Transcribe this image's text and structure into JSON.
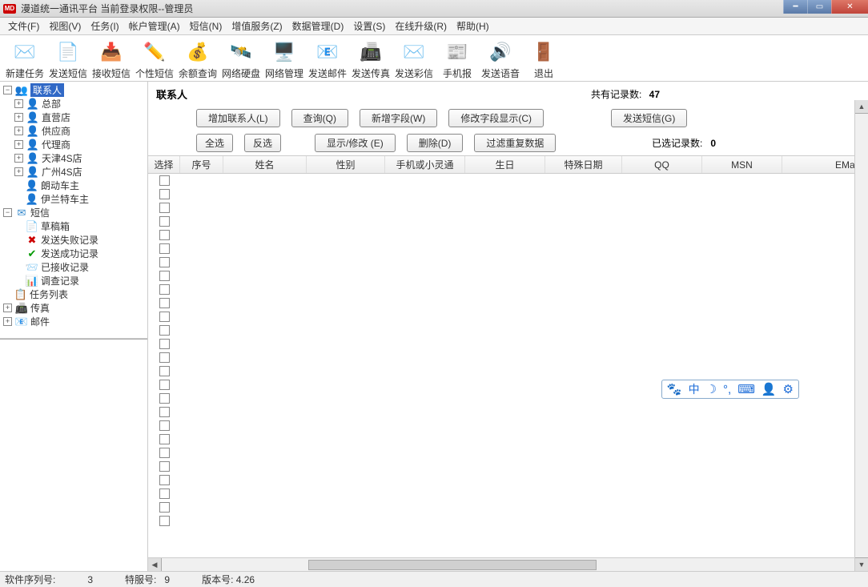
{
  "window": {
    "title": "漫道统一通讯平台 当前登录权限--管理员",
    "app_icon_text": "MD"
  },
  "menu": {
    "items": [
      "文件(F)",
      "视图(V)",
      "任务(I)",
      "帐户管理(A)",
      "短信(N)",
      "增值服务(Z)",
      "数据管理(D)",
      "设置(S)",
      "在线升级(R)",
      "帮助(H)"
    ]
  },
  "toolbar": {
    "items": [
      {
        "label": "新建任务",
        "icon": "✉️"
      },
      {
        "label": "发送短信",
        "icon": "📄"
      },
      {
        "label": "接收短信",
        "icon": "📥"
      },
      {
        "label": "个性短信",
        "icon": "✏️"
      },
      {
        "label": "余额查询",
        "icon": "💰"
      },
      {
        "label": "网络硬盘",
        "icon": "🛰️"
      },
      {
        "label": "网络管理",
        "icon": "🖥️"
      },
      {
        "label": "发送邮件",
        "icon": "📧"
      },
      {
        "label": "发送传真",
        "icon": "📠"
      },
      {
        "label": "发送彩信",
        "icon": "✉️"
      },
      {
        "label": "手机报",
        "icon": "📰"
      },
      {
        "label": "发送语音",
        "icon": "🔊"
      },
      {
        "label": "退出",
        "icon": "🚪"
      }
    ]
  },
  "tree": {
    "contacts_root": "联系人",
    "contacts_children": [
      "总部",
      "直营店",
      "供应商",
      "代理商",
      "天津4S店",
      "广州4S店",
      "朗动车主",
      "伊兰特车主"
    ],
    "sms_root": "短信",
    "sms_children": [
      {
        "label": "草稿箱",
        "icon": "📄"
      },
      {
        "label": "发送失败记录",
        "icon": "✖",
        "color": "#c00"
      },
      {
        "label": "发送成功记录",
        "icon": "✔",
        "color": "#090"
      },
      {
        "label": "已接收记录",
        "icon": "📨"
      },
      {
        "label": "调查记录",
        "icon": "📊"
      }
    ],
    "task_list": "任务列表",
    "fax": "传真",
    "mail": "邮件"
  },
  "content": {
    "title": "联系人",
    "total_label": "共有记录数:",
    "total_value": "47",
    "buttons_row1": [
      "增加联系人(L)",
      "查询(Q)",
      "新增字段(W)",
      "修改字段显示(C)"
    ],
    "send_sms_btn": "发送短信(G)",
    "buttons_row2": [
      "全选",
      "反选",
      "显示/修改 (E)",
      "删除(D)",
      "过滤重复数据"
    ],
    "selected_label": "已选记录数:",
    "selected_value": "0",
    "columns": [
      "选择",
      "序号",
      "姓名",
      "性别",
      "手机或小灵通",
      "生日",
      "特殊日期",
      "QQ",
      "MSN",
      "EMail"
    ]
  },
  "statusbar": {
    "serial_label": "软件序列号:",
    "serial_mid1": "3",
    "special_label": "特服号:",
    "special_val": "9",
    "version_label": "版本号: 4.26"
  },
  "ime": {
    "ch": "中"
  }
}
